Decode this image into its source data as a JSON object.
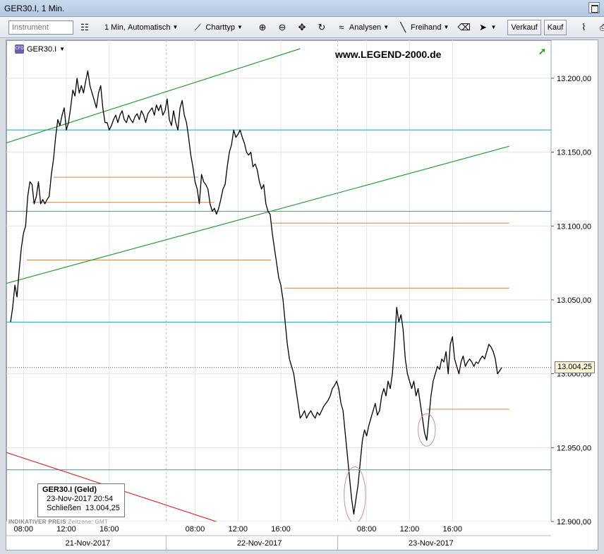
{
  "window": {
    "title": "GER30.I, 1 Min."
  },
  "toolbar": {
    "instrument_placeholder": "Instrument",
    "interval_label": "1 Min,",
    "mode_label": "Automatisch",
    "charttype_label": "Charttyp",
    "analysen_label": "Analysen",
    "freihand_label": "Freihand",
    "verkauf_label": "Verkauf",
    "kauf_label": "Kauf"
  },
  "chart": {
    "symbol": "GER30.I",
    "symbol_badge": "CFD",
    "watermark": "www.LEGEND-2000.de",
    "last_price_label": "13.004,25",
    "footer_text": "INDIKATIVER PREIS",
    "timezone_text": "Zeitzone: GMT",
    "info_box": {
      "title": "GER30.I (Geld)",
      "datetime": "23-Nov-2017 20:54",
      "close_label": "Schließen",
      "close_value": "13.004,25"
    }
  },
  "chart_data": {
    "type": "line",
    "ylim": [
      12900,
      13220
    ],
    "xlim": [
      0,
      50
    ],
    "y_ticks": [
      {
        "value": 12900,
        "label": "12.900,00"
      },
      {
        "value": 12950,
        "label": "12.950,00"
      },
      {
        "value": 13000,
        "label": "13.000,00"
      },
      {
        "value": 13050,
        "label": "13.050,00"
      },
      {
        "value": 13100,
        "label": "13.100,00"
      },
      {
        "value": 13150,
        "label": "13.150,00"
      },
      {
        "value": 13200,
        "label": "13.200,00"
      }
    ],
    "x_ticks": [
      {
        "x": 1.2,
        "label": "08:00"
      },
      {
        "x": 5.2,
        "label": "12:00"
      },
      {
        "x": 9.2,
        "label": "16:00"
      },
      {
        "x": 17.2,
        "label": "08:00"
      },
      {
        "x": 21.2,
        "label": "12:00"
      },
      {
        "x": 25.2,
        "label": "16:00"
      },
      {
        "x": 33.2,
        "label": "08:00"
      },
      {
        "x": 37.2,
        "label": "12:00"
      },
      {
        "x": 41.2,
        "label": "16:00"
      }
    ],
    "date_labels": [
      {
        "x": 7.2,
        "label": "21-Nov-2017"
      },
      {
        "x": 23.2,
        "label": "22-Nov-2017"
      },
      {
        "x": 39.2,
        "label": "23-Nov-2017"
      }
    ],
    "day_separators": [
      14.5,
      30.5
    ],
    "grid": true,
    "last_price": 13004.25,
    "series": [
      {
        "color": "#000000",
        "points": [
          [
            0.0,
            13035
          ],
          [
            0.2,
            13045
          ],
          [
            0.4,
            13060
          ],
          [
            0.6,
            13052
          ],
          [
            0.8,
            13070
          ],
          [
            1.0,
            13085
          ],
          [
            1.2,
            13095
          ],
          [
            1.4,
            13100
          ],
          [
            1.6,
            13120
          ],
          [
            1.8,
            13130
          ],
          [
            2.0,
            13128
          ],
          [
            2.2,
            13115
          ],
          [
            2.4,
            13120
          ],
          [
            2.6,
            13130
          ],
          [
            2.8,
            13115
          ],
          [
            3.0,
            13118
          ],
          [
            3.2,
            13115
          ],
          [
            3.4,
            13118
          ],
          [
            3.6,
            13120
          ],
          [
            3.8,
            13135
          ],
          [
            4.0,
            13145
          ],
          [
            4.2,
            13160
          ],
          [
            4.4,
            13172
          ],
          [
            4.6,
            13168
          ],
          [
            4.8,
            13175
          ],
          [
            5.0,
            13180
          ],
          [
            5.2,
            13165
          ],
          [
            5.4,
            13170
          ],
          [
            5.6,
            13180
          ],
          [
            5.8,
            13192
          ],
          [
            6.0,
            13188
          ],
          [
            6.2,
            13200
          ],
          [
            6.4,
            13190
          ],
          [
            6.6,
            13195
          ],
          [
            6.8,
            13190
          ],
          [
            7.0,
            13198
          ],
          [
            7.2,
            13205
          ],
          [
            7.4,
            13195
          ],
          [
            7.6,
            13190
          ],
          [
            7.8,
            13185
          ],
          [
            8.0,
            13180
          ],
          [
            8.2,
            13190
          ],
          [
            8.4,
            13195
          ],
          [
            8.6,
            13180
          ],
          [
            8.8,
            13170
          ],
          [
            9.0,
            13170
          ],
          [
            9.2,
            13165
          ],
          [
            9.4,
            13168
          ],
          [
            9.6,
            13172
          ],
          [
            9.8,
            13175
          ],
          [
            10.0,
            13170
          ],
          [
            10.2,
            13175
          ],
          [
            10.4,
            13178
          ],
          [
            10.6,
            13172
          ],
          [
            10.8,
            13170
          ],
          [
            11.0,
            13175
          ],
          [
            11.2,
            13172
          ],
          [
            11.4,
            13170
          ],
          [
            11.6,
            13174
          ],
          [
            11.8,
            13176
          ],
          [
            12.0,
            13172
          ],
          [
            12.2,
            13178
          ],
          [
            12.4,
            13175
          ],
          [
            12.6,
            13170
          ],
          [
            12.8,
            13176
          ],
          [
            13.0,
            13178
          ],
          [
            13.2,
            13180
          ],
          [
            13.4,
            13175
          ],
          [
            13.6,
            13182
          ],
          [
            13.8,
            13178
          ],
          [
            14.0,
            13182
          ],
          [
            14.2,
            13175
          ],
          [
            14.4,
            13178
          ],
          [
            14.6,
            13186
          ],
          [
            14.8,
            13172
          ],
          [
            15.0,
            13168
          ],
          [
            15.2,
            13178
          ],
          [
            15.4,
            13170
          ],
          [
            15.6,
            13165
          ],
          [
            15.8,
            13180
          ],
          [
            16.0,
            13185
          ],
          [
            16.2,
            13175
          ],
          [
            16.4,
            13170
          ],
          [
            16.6,
            13160
          ],
          [
            16.8,
            13148
          ],
          [
            17.0,
            13140
          ],
          [
            17.2,
            13130
          ],
          [
            17.4,
            13125
          ],
          [
            17.6,
            13115
          ],
          [
            17.8,
            13135
          ],
          [
            18.0,
            13130
          ],
          [
            18.2,
            13128
          ],
          [
            18.4,
            13125
          ],
          [
            18.6,
            13115
          ],
          [
            18.8,
            13110
          ],
          [
            19.0,
            13112
          ],
          [
            19.2,
            13108
          ],
          [
            19.4,
            13112
          ],
          [
            19.6,
            13118
          ],
          [
            19.8,
            13125
          ],
          [
            20.0,
            13128
          ],
          [
            20.2,
            13140
          ],
          [
            20.4,
            13150
          ],
          [
            20.6,
            13155
          ],
          [
            20.8,
            13165
          ],
          [
            21.0,
            13160
          ],
          [
            21.2,
            13162
          ],
          [
            21.4,
            13165
          ],
          [
            21.6,
            13160
          ],
          [
            21.8,
            13156
          ],
          [
            22.0,
            13150
          ],
          [
            22.2,
            13148
          ],
          [
            22.4,
            13150
          ],
          [
            22.6,
            13140
          ],
          [
            22.8,
            13142
          ],
          [
            23.0,
            13138
          ],
          [
            23.2,
            13130
          ],
          [
            23.4,
            13125
          ],
          [
            23.6,
            13128
          ],
          [
            23.8,
            13115
          ],
          [
            24.0,
            13110
          ],
          [
            24.2,
            13108
          ],
          [
            24.4,
            13095
          ],
          [
            24.6,
            13085
          ],
          [
            24.8,
            13075
          ],
          [
            25.0,
            13065
          ],
          [
            25.2,
            13060
          ],
          [
            25.4,
            13050
          ],
          [
            25.6,
            13035
          ],
          [
            25.8,
            13020
          ],
          [
            26.0,
            13010
          ],
          [
            26.2,
            13005
          ],
          [
            26.4,
            13000
          ],
          [
            26.6,
            12990
          ],
          [
            26.8,
            12980
          ],
          [
            27.0,
            12970
          ],
          [
            27.2,
            12972
          ],
          [
            27.4,
            12975
          ],
          [
            27.6,
            12970
          ],
          [
            27.8,
            12973
          ],
          [
            28.0,
            12975
          ],
          [
            28.2,
            12972
          ],
          [
            28.4,
            12970
          ],
          [
            28.6,
            12974
          ],
          [
            28.8,
            12972
          ],
          [
            29.0,
            12975
          ],
          [
            29.2,
            12978
          ],
          [
            29.4,
            12980
          ],
          [
            29.6,
            12982
          ],
          [
            29.8,
            12985
          ],
          [
            30.0,
            12990
          ],
          [
            30.2,
            12992
          ],
          [
            30.4,
            12995
          ],
          [
            30.6,
            12990
          ],
          [
            30.8,
            12980
          ],
          [
            31.0,
            12975
          ],
          [
            31.2,
            12960
          ],
          [
            31.4,
            12945
          ],
          [
            31.6,
            12930
          ],
          [
            31.8,
            12915
          ],
          [
            32.0,
            12905
          ],
          [
            32.2,
            12915
          ],
          [
            32.4,
            12925
          ],
          [
            32.6,
            12940
          ],
          [
            32.8,
            12955
          ],
          [
            33.0,
            12962
          ],
          [
            33.2,
            12958
          ],
          [
            33.4,
            12965
          ],
          [
            33.6,
            12970
          ],
          [
            33.8,
            12975
          ],
          [
            34.0,
            12980
          ],
          [
            34.2,
            12972
          ],
          [
            34.4,
            12975
          ],
          [
            34.6,
            12985
          ],
          [
            34.8,
            12990
          ],
          [
            35.0,
            12985
          ],
          [
            35.2,
            12995
          ],
          [
            35.4,
            12990
          ],
          [
            35.6,
            13000
          ],
          [
            35.8,
            13020
          ],
          [
            36.0,
            13045
          ],
          [
            36.2,
            13035
          ],
          [
            36.4,
            13040
          ],
          [
            36.6,
            13030
          ],
          [
            36.8,
            13010
          ],
          [
            37.0,
            13000
          ],
          [
            37.2,
            12995
          ],
          [
            37.4,
            12990
          ],
          [
            37.6,
            12995
          ],
          [
            37.8,
            12985
          ],
          [
            38.0,
            12990
          ],
          [
            38.2,
            12980
          ],
          [
            38.4,
            12970
          ],
          [
            38.6,
            12960
          ],
          [
            38.8,
            12955
          ],
          [
            39.0,
            12970
          ],
          [
            39.2,
            12985
          ],
          [
            39.4,
            12995
          ],
          [
            39.6,
            13000
          ],
          [
            39.8,
            13005
          ],
          [
            40.0,
            13003
          ],
          [
            40.2,
            13010
          ],
          [
            40.4,
            13008
          ],
          [
            40.6,
            13015
          ],
          [
            40.8,
            13000
          ],
          [
            41.0,
            13020
          ],
          [
            41.2,
            13025
          ],
          [
            41.4,
            13010
          ],
          [
            41.6,
            13005
          ],
          [
            41.8,
            13000
          ],
          [
            42.0,
            13008
          ],
          [
            42.2,
            13012
          ],
          [
            42.4,
            13005
          ],
          [
            42.6,
            13008
          ],
          [
            42.8,
            13010
          ],
          [
            43.0,
            13008
          ],
          [
            43.2,
            13005
          ],
          [
            43.4,
            13008
          ],
          [
            43.6,
            13007
          ],
          [
            43.8,
            13010
          ],
          [
            44.0,
            13012
          ],
          [
            44.2,
            13010
          ],
          [
            44.4,
            13015
          ],
          [
            44.6,
            13020
          ],
          [
            44.8,
            13018
          ],
          [
            45.0,
            13015
          ],
          [
            45.2,
            13010
          ],
          [
            45.4,
            13000
          ],
          [
            45.6,
            13002
          ],
          [
            45.8,
            13004.25
          ]
        ]
      }
    ],
    "support_resistance_lines": {
      "color": "#2e9fa8",
      "levels": [
        12935,
        13035,
        13110,
        13165
      ]
    },
    "segment_lines": {
      "color": "#c8864a",
      "segments": [
        {
          "x1": 4.0,
          "x2": 17.5,
          "y": 13133
        },
        {
          "x1": 2.0,
          "x2": 19.0,
          "y": 13116
        },
        {
          "x1": 1.5,
          "x2": 24.3,
          "y": 13077
        },
        {
          "x1": 24.3,
          "x2": 46.5,
          "y": 13102
        },
        {
          "x1": 25.5,
          "x2": 46.5,
          "y": 13058
        },
        {
          "x1": 38.8,
          "x2": 46.5,
          "y": 12976
        }
      ]
    },
    "trend_lines": [
      {
        "color": "#2a9b3a",
        "x1": -0.5,
        "y1": 13156,
        "x2": 27.0,
        "y2": 13220
      },
      {
        "color": "#2a9b3a",
        "x1": -0.5,
        "y1": 13061,
        "x2": 46.5,
        "y2": 13154
      },
      {
        "color": "#d0312d",
        "x1": -0.5,
        "y1": 12947,
        "x2": 20.0,
        "y2": 12898
      }
    ],
    "highlight_ellipses": [
      {
        "color": "#d98a94",
        "cx": 32.1,
        "cy": 12918,
        "rx": 1.0,
        "ry": 19
      },
      {
        "color": "#d98a94",
        "cx": 38.8,
        "cy": 12962,
        "rx": 0.8,
        "ry": 11
      }
    ]
  }
}
